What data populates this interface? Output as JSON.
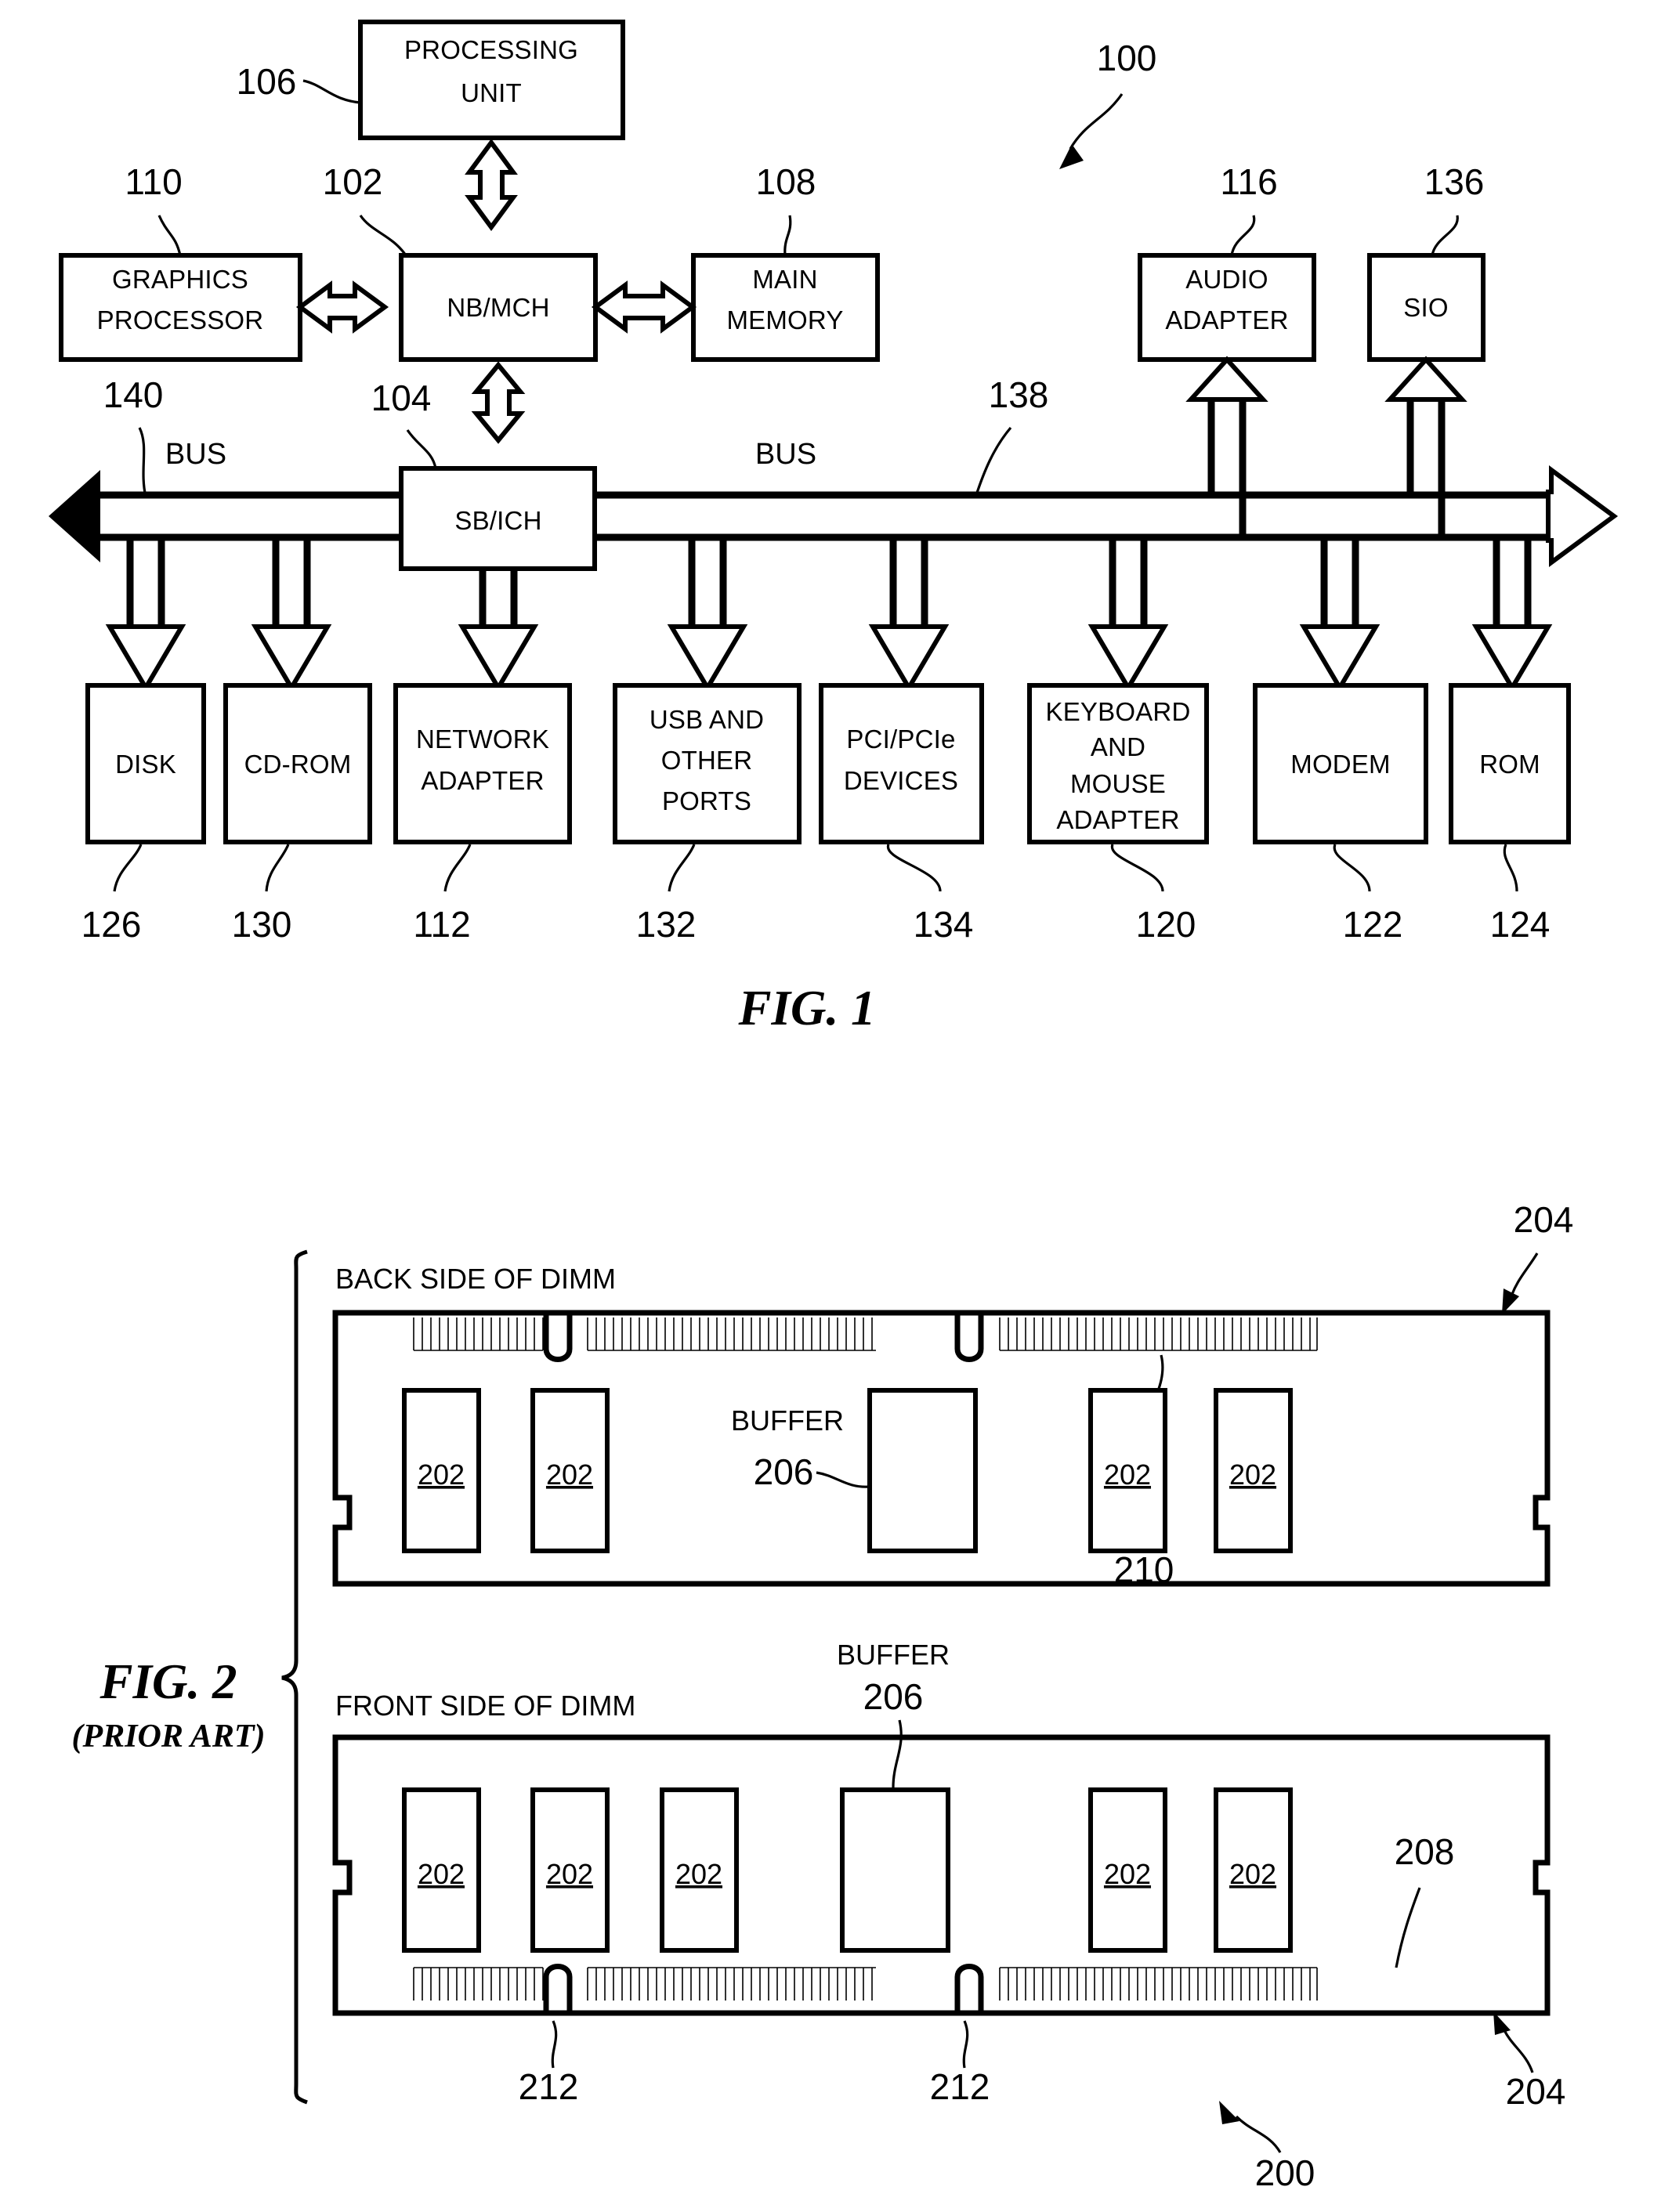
{
  "figure1": {
    "caption": "FIG. 1",
    "system_ref": "100",
    "boxes": [
      {
        "id": "processing-unit",
        "label": "PROCESSING UNIT",
        "lines": [
          "PROCESSING",
          "UNIT"
        ],
        "ref": "106"
      },
      {
        "id": "graphics-processor",
        "label": "GRAPHICS PROCESSOR",
        "lines": [
          "GRAPHICS",
          "PROCESSOR"
        ],
        "ref": "110"
      },
      {
        "id": "nb-mch",
        "label": "NB/MCH",
        "lines": [
          "NB/MCH"
        ],
        "ref": "102"
      },
      {
        "id": "main-memory",
        "label": "MAIN MEMORY",
        "lines": [
          "MAIN",
          "MEMORY"
        ],
        "ref": "108"
      },
      {
        "id": "audio-adapter",
        "label": "AUDIO ADAPTER",
        "lines": [
          "AUDIO",
          "ADAPTER"
        ],
        "ref": "116"
      },
      {
        "id": "sio",
        "label": "SIO",
        "lines": [
          "SIO"
        ],
        "ref": "136"
      },
      {
        "id": "sb-ich",
        "label": "SB/ICH",
        "lines": [
          "SB/ICH"
        ],
        "ref": "104"
      },
      {
        "id": "disk",
        "label": "DISK",
        "lines": [
          "DISK"
        ],
        "ref": "126"
      },
      {
        "id": "cd-rom",
        "label": "CD-ROM",
        "lines": [
          "CD-ROM"
        ],
        "ref": "130"
      },
      {
        "id": "network-adapter",
        "label": "NETWORK ADAPTER",
        "lines": [
          "NETWORK",
          "ADAPTER"
        ],
        "ref": "112"
      },
      {
        "id": "usb-other-ports",
        "label": "USB AND OTHER PORTS",
        "lines": [
          "USB AND",
          "OTHER",
          "PORTS"
        ],
        "ref": "132"
      },
      {
        "id": "pci-pcie-devices",
        "label": "PCI/PCIe DEVICES",
        "lines": [
          "PCI/PCIe",
          "DEVICES"
        ],
        "ref": "134"
      },
      {
        "id": "keyboard-mouse-adapter",
        "label": "KEYBOARD AND MOUSE ADAPTER",
        "lines": [
          "KEYBOARD",
          "AND",
          "MOUSE",
          "ADAPTER"
        ],
        "ref": "120"
      },
      {
        "id": "modem",
        "label": "MODEM",
        "lines": [
          "MODEM"
        ],
        "ref": "122"
      },
      {
        "id": "rom",
        "label": "ROM",
        "lines": [
          "ROM"
        ],
        "ref": "124"
      }
    ],
    "bus_left_label": "BUS",
    "bus_right_label": "BUS",
    "bus_left_ref": "140",
    "bus_right_ref": "138"
  },
  "figure2": {
    "caption": "FIG. 2",
    "caption_sub": "(PRIOR ART)",
    "assembly_ref": "200",
    "back": {
      "title": "BACK SIDE OF DIMM",
      "buffer_label": "BUFFER",
      "buffer_ref": "206",
      "pcb_ref": "204",
      "pins_ref": "210",
      "chip_ref": "202",
      "chips_left": [
        "202",
        "202"
      ],
      "chips_right": [
        "202",
        "202"
      ]
    },
    "front": {
      "title": "FRONT SIDE OF DIMM",
      "buffer_label": "BUFFER",
      "buffer_ref": "206",
      "pcb_ref": "204",
      "pins_ref": "208",
      "notch_ref_1": "212",
      "notch_ref_2": "212",
      "chip_ref": "202",
      "chips_left": [
        "202",
        "202",
        "202"
      ],
      "chips_right": [
        "202",
        "202"
      ]
    }
  },
  "colors": {
    "ink": "#000000",
    "paper": "#ffffff"
  }
}
